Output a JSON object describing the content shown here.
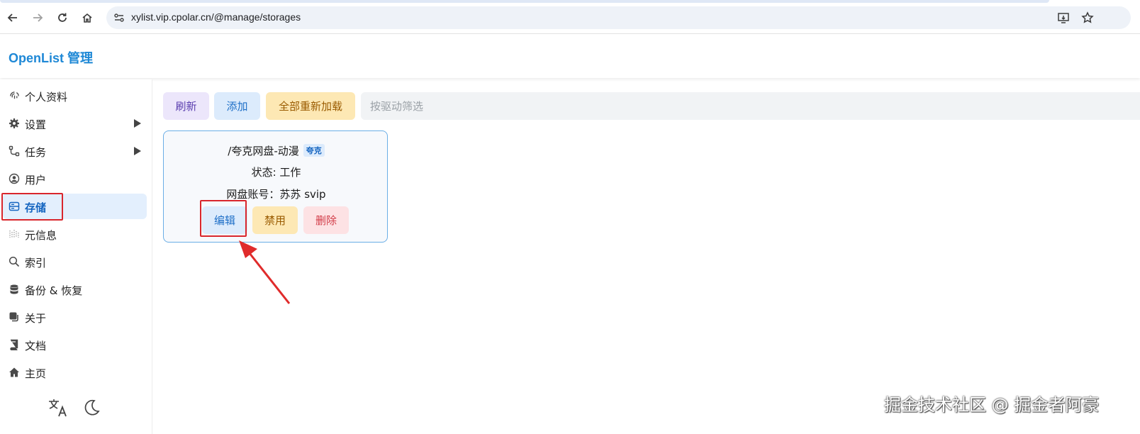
{
  "browser": {
    "url": "xylist.vip.cpolar.cn/@manage/storages"
  },
  "header": {
    "brand": "OpenList 管理"
  },
  "sidebar": {
    "items": [
      {
        "label": "个人资料",
        "icon": "fingerprint-icon"
      },
      {
        "label": "设置",
        "icon": "gear-icon"
      },
      {
        "label": "任务",
        "icon": "tasks-icon"
      },
      {
        "label": "用户",
        "icon": "user-icon"
      },
      {
        "label": "存储",
        "icon": "storage-icon"
      },
      {
        "label": "元信息",
        "icon": "meta-icon"
      },
      {
        "label": "索引",
        "icon": "search-icon"
      },
      {
        "label": "备份 & 恢复",
        "icon": "database-icon"
      },
      {
        "label": "关于",
        "icon": "about-icon"
      },
      {
        "label": "文档",
        "icon": "book-icon"
      },
      {
        "label": "主页",
        "icon": "home-icon"
      }
    ]
  },
  "toolbar": {
    "refresh_label": "刷新",
    "add_label": "添加",
    "reload_all_label": "全部重新加载",
    "filter_placeholder": "按驱动筛选"
  },
  "storage_card": {
    "mount_path": "/夸克网盘-动漫",
    "driver_tag": "夸克",
    "status": "状态: 工作",
    "account": "网盘账号：苏苏 svip",
    "edit_label": "编辑",
    "disable_label": "禁用",
    "delete_label": "删除"
  },
  "watermark": "掘金技术社区 @ 掘金者阿豪",
  "colors": {
    "accent": "#1e88d6",
    "active_bg": "#e3effd",
    "annotation_red": "#d9262c"
  }
}
